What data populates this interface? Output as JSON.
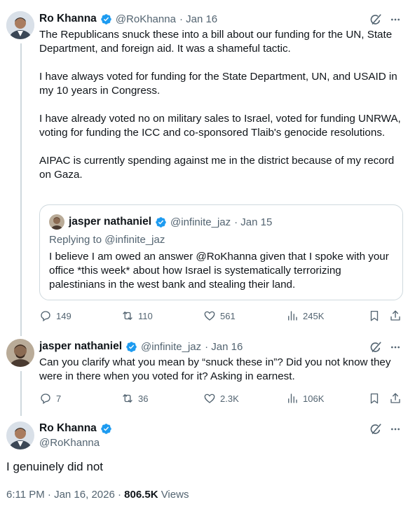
{
  "tweet1": {
    "name": "Ro Khanna",
    "handle": "@RoKhanna",
    "date": "· Jan 16",
    "paragraphs": [
      "The Republicans snuck these into a bill about our funding for the UN, State Department, and foreign aid. It was a shameful tactic.",
      "I have always voted for funding for the State Department, UN, and USAID in my 10 years in Congress.",
      "I have already voted no on military sales to Israel, voted for funding UNRWA, voting for funding the ICC and co-sponsored Tlaib's genocide resolutions.",
      "AIPAC is currently spending against me in the district because of my record on Gaza."
    ],
    "quote": {
      "name": "jasper nathaniel",
      "handle": "@infinite_jaz",
      "date": "· Jan 15",
      "replying_prefix": "Replying to ",
      "replying_handle": "@infinite_jaz",
      "text": "I believe I am owed an answer @RoKhanna given that I spoke with your office *this week* about how Israel is systematically terrorizing palestinians in the west bank and stealing their land."
    },
    "stats": {
      "replies": "149",
      "reposts": "110",
      "likes": "561",
      "views": "245K"
    }
  },
  "tweet2": {
    "name": "jasper nathaniel",
    "handle": "@infinite_jaz",
    "date": "· Jan 16",
    "text": "Can you clarify what you mean by “snuck these in”? Did you not know they were in there when you voted for it? Asking in earnest.",
    "stats": {
      "replies": "7",
      "reposts": "36",
      "likes": "2.3K",
      "views": "106K"
    }
  },
  "tweet3": {
    "name": "Ro Khanna",
    "handle": "@RoKhanna",
    "text": "I genuinely did not",
    "timestamp": "6:11 PM · Jan 16, 2026 · ",
    "views_count": "806.5K",
    "views_label": " Views"
  },
  "icons": {
    "verified": "verified-badge-icon",
    "grok": "grok-icon",
    "more": "more-icon",
    "reply": "reply-icon",
    "repost": "repost-icon",
    "like": "like-icon",
    "views": "views-icon",
    "bookmark": "bookmark-icon",
    "share": "share-icon"
  },
  "colors": {
    "verified": "#1d9bf0",
    "secondary_text": "#536471",
    "link": "#1d9bf0",
    "border": "#cfd9de"
  }
}
